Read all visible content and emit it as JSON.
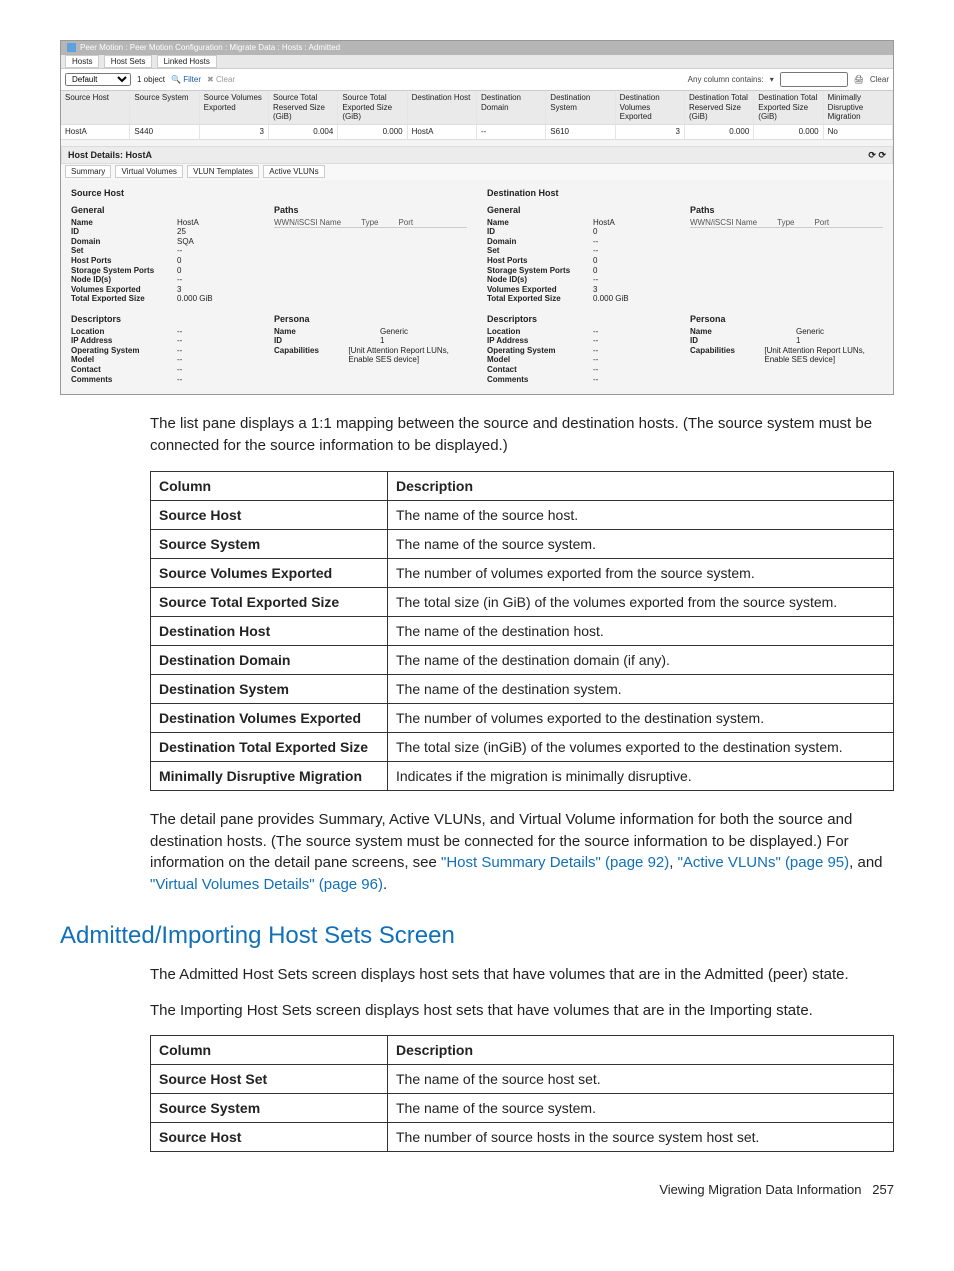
{
  "screenshot": {
    "breadcrumb": "Peer Motion : Peer Motion Configuration : Migrate Data : Hosts : Admitted",
    "top_tabs": [
      "Hosts",
      "Host Sets",
      "Linked Hosts"
    ],
    "toolbar": {
      "dropdown": "Default",
      "objects": "1 object",
      "filter": "Filter",
      "clear": "Clear",
      "any_column": "Any column contains:",
      "right_clear": "Clear"
    },
    "grid": {
      "columns": [
        "Source Host",
        "Source System",
        "Source Volumes Exported",
        "Source Total Reserved Size (GiB)",
        "Source Total Exported Size (GiB)",
        "Destination Host",
        "Destination Domain",
        "Destination System",
        "Destination Volumes Exported",
        "Destination Total Reserved Size (GiB)",
        "Destination Total Exported Size (GiB)",
        "Minimally Disruptive Migration"
      ],
      "row": [
        "HostA",
        "S440",
        "3",
        "0.004",
        "0.000",
        "HostA",
        "--",
        "S610",
        "3",
        "0.000",
        "0.000",
        "No"
      ]
    },
    "details_title": "Host Details: HostA",
    "sub_tabs": [
      "Summary",
      "Virtual Volumes",
      "VLUN Templates",
      "Active VLUNs"
    ],
    "source": {
      "header": "Source Host",
      "general": "General",
      "paths": "Paths",
      "paths_cols": [
        "WWN/iSCSI Name",
        "Type",
        "Port"
      ],
      "kv": [
        [
          "Name",
          "HostA"
        ],
        [
          "ID",
          "25"
        ],
        [
          "Domain",
          "SQA"
        ],
        [
          "Set",
          "--"
        ],
        [
          "Host Ports",
          "0"
        ],
        [
          "Storage System Ports",
          "0"
        ],
        [
          "Node ID(s)",
          "--"
        ],
        [
          "Volumes Exported",
          "3"
        ],
        [
          "Total Exported Size",
          "0.000 GiB"
        ]
      ],
      "descriptors": "Descriptors",
      "desc_kv": [
        [
          "Location",
          "--"
        ],
        [
          "IP Address",
          "--"
        ],
        [
          "Operating System",
          "--"
        ],
        [
          "Model",
          "--"
        ],
        [
          "Contact",
          "--"
        ],
        [
          "Comments",
          "--"
        ]
      ],
      "persona": "Persona",
      "persona_kv": [
        [
          "Name",
          "Generic"
        ],
        [
          "ID",
          "1"
        ],
        [
          "Capabilities",
          "[Unit Attention Report LUNs, Enable SES device]"
        ]
      ]
    },
    "dest": {
      "header": "Destination Host",
      "general": "General",
      "paths": "Paths",
      "paths_cols": [
        "WWN/iSCSI Name",
        "Type",
        "Port"
      ],
      "kv": [
        [
          "Name",
          "HostA"
        ],
        [
          "ID",
          "0"
        ],
        [
          "Domain",
          "--"
        ],
        [
          "Set",
          "--"
        ],
        [
          "Host Ports",
          "0"
        ],
        [
          "Storage System Ports",
          "0"
        ],
        [
          "Node ID(s)",
          "--"
        ],
        [
          "Volumes Exported",
          "3"
        ],
        [
          "Total Exported Size",
          "0.000 GiB"
        ]
      ],
      "descriptors": "Descriptors",
      "desc_kv": [
        [
          "Location",
          "--"
        ],
        [
          "IP Address",
          "--"
        ],
        [
          "Operating System",
          "--"
        ],
        [
          "Model",
          "--"
        ],
        [
          "Contact",
          "--"
        ],
        [
          "Comments",
          "--"
        ]
      ],
      "persona": "Persona",
      "persona_kv": [
        [
          "Name",
          "Generic"
        ],
        [
          "ID",
          "1"
        ],
        [
          "Capabilities",
          "[Unit Attention Report LUNs, Enable SES device]"
        ]
      ]
    }
  },
  "para1": "The list pane displays a 1:1 mapping between the source and destination hosts. (The source system must be connected for the source information to be displayed.)",
  "table1": {
    "headers": [
      "Column",
      "Description"
    ],
    "rows": [
      [
        "Source Host",
        "The name of the source host."
      ],
      [
        "Source System",
        "The name of the source system."
      ],
      [
        "Source Volumes Exported",
        "The number of volumes exported from the source system."
      ],
      [
        "Source Total Exported Size",
        "The total size (in GiB) of the volumes exported from the source system."
      ],
      [
        "Destination Host",
        "The name of the destination host."
      ],
      [
        "Destination Domain",
        "The name of the destination domain (if any)."
      ],
      [
        "Destination System",
        "The name of the destination system."
      ],
      [
        "Destination Volumes Exported",
        "The number of volumes exported to the destination system."
      ],
      [
        "Destination Total Exported Size",
        "The total size (inGiB) of the volumes exported to the destination system."
      ],
      [
        "Minimally Disruptive Migration",
        "Indicates if the migration is minimally disruptive."
      ]
    ]
  },
  "para2_pre": "The detail pane provides Summary, Active VLUNs, and Virtual Volume information for both the source and destination hosts. (The source system must be connected for the source information to be displayed.) For information on the detail pane screens, see ",
  "links": {
    "l1": "\"Host Summary Details\" (page 92)",
    "l2": "\"Active VLUNs\" (page 95)",
    "l3": "\"Virtual Volumes Details\" (page 96)"
  },
  "para2_mid1": ", ",
  "para2_mid2": ", and ",
  "para2_end": ".",
  "section_heading": "Admitted/Importing Host Sets Screen",
  "para3": "The Admitted Host Sets screen displays host sets that have volumes that are in the Admitted (peer) state.",
  "para4": "The Importing Host Sets screen displays host sets that have volumes that are in the Importing state.",
  "table2": {
    "headers": [
      "Column",
      "Description"
    ],
    "rows": [
      [
        "Source Host Set",
        "The name of the source host set."
      ],
      [
        "Source System",
        "The name of the source system."
      ],
      [
        "Source Host",
        "The number of source hosts in the source system host set."
      ]
    ]
  },
  "footer_text": "Viewing Migration Data Information",
  "footer_page": "257"
}
